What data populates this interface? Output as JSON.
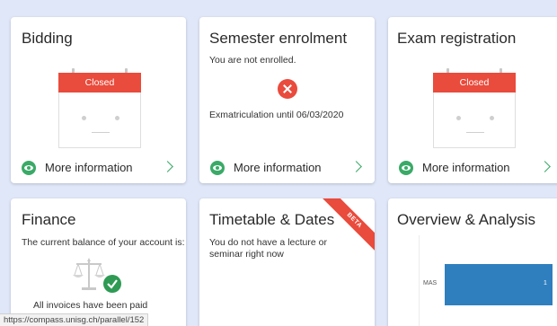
{
  "cards": {
    "bidding": {
      "title": "Bidding",
      "calendar_status": "Closed",
      "more_label": "More information"
    },
    "semester": {
      "title": "Semester enrolment",
      "status_text": "You are not enrolled.",
      "exmatriculation_text": "Exmatriculation until 06/03/2020",
      "more_label": "More information"
    },
    "exam": {
      "title": "Exam registration",
      "calendar_status": "Closed",
      "more_label": "More information"
    },
    "finance": {
      "title": "Finance",
      "balance_text": "The current balance of your account is:",
      "paid_text": "All invoices have been paid"
    },
    "timetable": {
      "title": "Timetable & Dates",
      "ribbon": "BETA",
      "status_text": "You do not have a lecture or seminar right now"
    },
    "overview": {
      "title": "Overview & Analysis"
    }
  },
  "status_bar": {
    "url": "https://compass.unisg.ch/parallel/152"
  },
  "colors": {
    "accent_green": "#3aaa67",
    "alert_red": "#e94b3c",
    "bar_blue": "#2f7fbf",
    "background": "#dfe7f8"
  },
  "chart_data": {
    "type": "bar",
    "categories": [
      "MAS"
    ],
    "values": [
      1
    ],
    "orientation": "horizontal"
  }
}
